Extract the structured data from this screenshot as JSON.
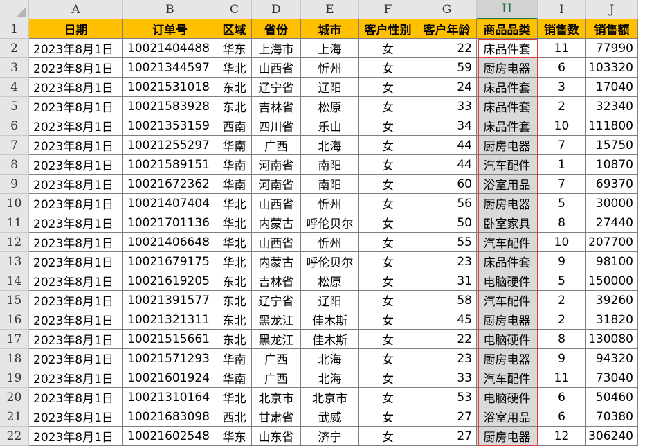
{
  "columns": [
    "A",
    "B",
    "C",
    "D",
    "E",
    "F",
    "G",
    "H",
    "I",
    "J"
  ],
  "headers": [
    "日期",
    "订单号",
    "区域",
    "省份",
    "城市",
    "客户性别",
    "客户年龄",
    "商品品类",
    "销售数",
    "销售额"
  ],
  "rows": [
    [
      "2023年8月1日",
      "10021404488",
      "华东",
      "上海市",
      "上海",
      "女",
      "22",
      "床品件套",
      "11",
      "77990"
    ],
    [
      "2023年8月1日",
      "10021344597",
      "华北",
      "山西省",
      "忻州",
      "女",
      "59",
      "厨房电器",
      "6",
      "103320"
    ],
    [
      "2023年8月1日",
      "10021531018",
      "东北",
      "辽宁省",
      "辽阳",
      "女",
      "24",
      "床品件套",
      "3",
      "17040"
    ],
    [
      "2023年8月1日",
      "10021583928",
      "东北",
      "吉林省",
      "松原",
      "女",
      "33",
      "床品件套",
      "2",
      "32340"
    ],
    [
      "2023年8月1日",
      "10021353159",
      "西南",
      "四川省",
      "乐山",
      "女",
      "34",
      "床品件套",
      "10",
      "111800"
    ],
    [
      "2023年8月1日",
      "10021255297",
      "华南",
      "广西",
      "北海",
      "女",
      "44",
      "厨房电器",
      "7",
      "15750"
    ],
    [
      "2023年8月1日",
      "10021589151",
      "华南",
      "河南省",
      "南阳",
      "女",
      "44",
      "汽车配件",
      "1",
      "10870"
    ],
    [
      "2023年8月1日",
      "10021672362",
      "华南",
      "河南省",
      "南阳",
      "女",
      "60",
      "浴室用品",
      "7",
      "69370"
    ],
    [
      "2023年8月1日",
      "10021407404",
      "华北",
      "山西省",
      "忻州",
      "女",
      "56",
      "厨房电器",
      "5",
      "30000"
    ],
    [
      "2023年8月1日",
      "10021701136",
      "华北",
      "内蒙古",
      "呼伦贝尔",
      "女",
      "50",
      "卧室家具",
      "8",
      "27440"
    ],
    [
      "2023年8月1日",
      "10021406648",
      "华北",
      "山西省",
      "忻州",
      "女",
      "55",
      "汽车配件",
      "10",
      "207700"
    ],
    [
      "2023年8月1日",
      "10021679175",
      "华北",
      "内蒙古",
      "呼伦贝尔",
      "女",
      "23",
      "床品件套",
      "9",
      "98100"
    ],
    [
      "2023年8月1日",
      "10021619205",
      "东北",
      "吉林省",
      "松原",
      "女",
      "31",
      "电脑硬件",
      "5",
      "150000"
    ],
    [
      "2023年8月1日",
      "10021391577",
      "东北",
      "辽宁省",
      "辽阳",
      "女",
      "58",
      "汽车配件",
      "2",
      "39260"
    ],
    [
      "2023年8月1日",
      "10021321311",
      "东北",
      "黑龙江",
      "佳木斯",
      "女",
      "45",
      "厨房电器",
      "2",
      "31820"
    ],
    [
      "2023年8月1日",
      "10021515661",
      "东北",
      "黑龙江",
      "佳木斯",
      "女",
      "22",
      "电脑硬件",
      "8",
      "130080"
    ],
    [
      "2023年8月1日",
      "10021571293",
      "华南",
      "广西",
      "北海",
      "女",
      "23",
      "厨房电器",
      "9",
      "94320"
    ],
    [
      "2023年8月1日",
      "10021601924",
      "华南",
      "广西",
      "北海",
      "女",
      "33",
      "汽车配件",
      "11",
      "73040"
    ],
    [
      "2023年8月1日",
      "10021310164",
      "华北",
      "北京市",
      "北京市",
      "女",
      "53",
      "电脑硬件",
      "6",
      "50460"
    ],
    [
      "2023年8月1日",
      "10021683098",
      "西北",
      "甘肃省",
      "武威",
      "女",
      "27",
      "浴室用品",
      "6",
      "70380"
    ],
    [
      "2023年8月1日",
      "10021602548",
      "华东",
      "山东省",
      "济宁",
      "女",
      "27",
      "厨房电器",
      "12",
      "306240"
    ]
  ],
  "selected_column": "H",
  "colors": {
    "header_fill": "#ffc000",
    "selection_border": "#e03c3c",
    "selection_fill": "#d9d9d9"
  }
}
